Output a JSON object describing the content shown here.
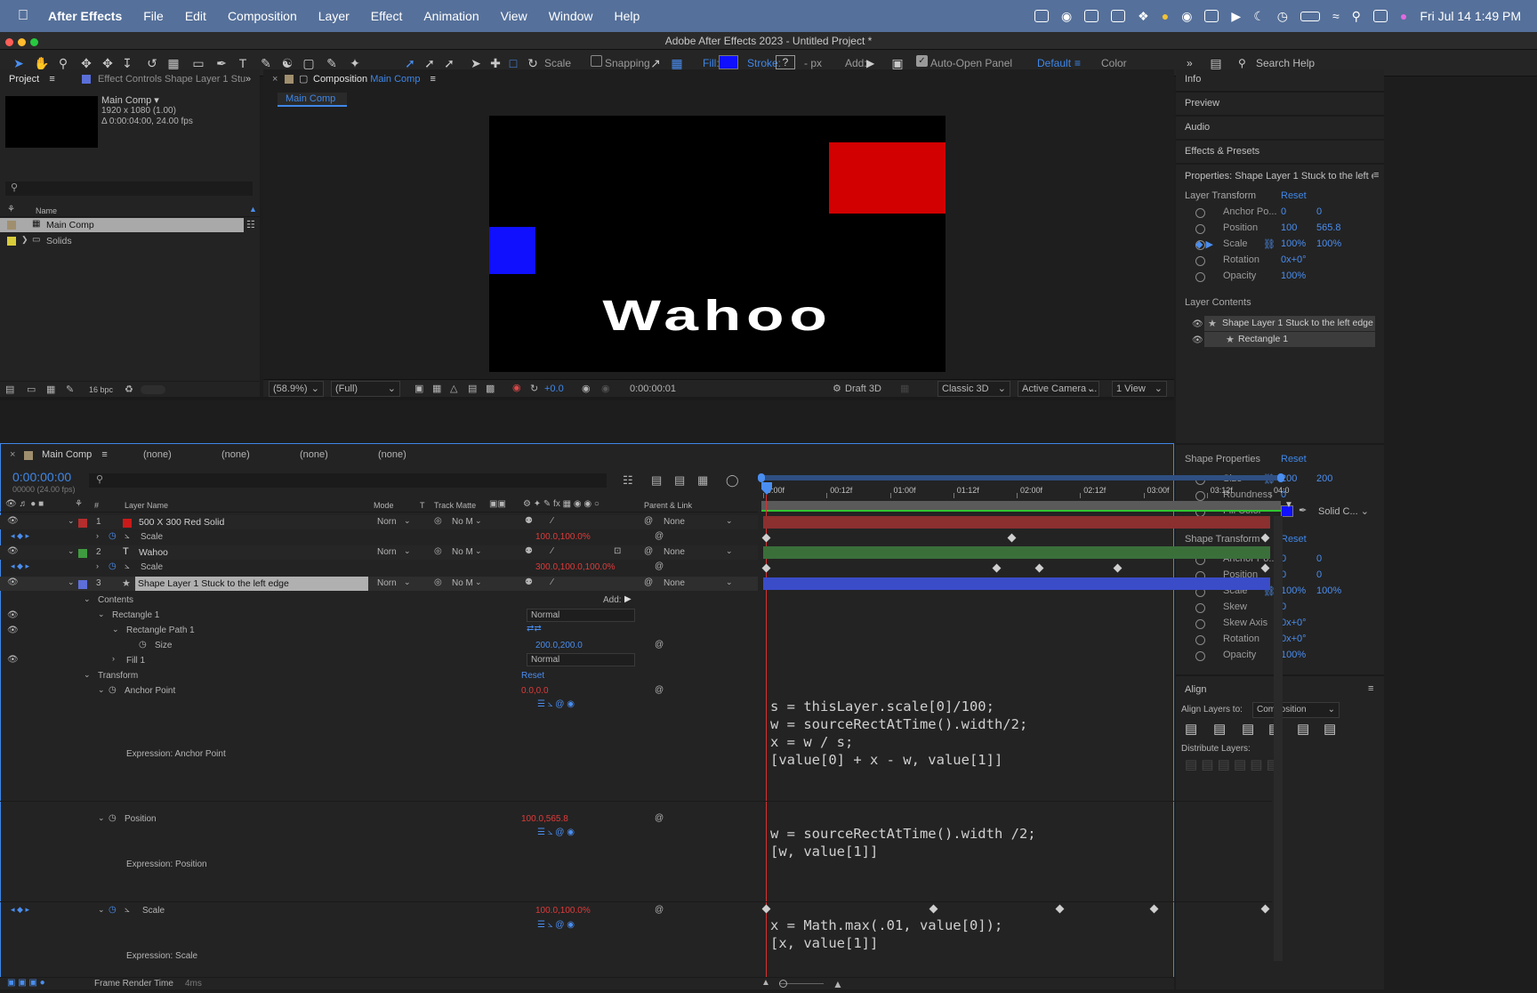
{
  "menubar": {
    "app": "After Effects",
    "items": [
      "File",
      "Edit",
      "Composition",
      "Layer",
      "Effect",
      "Animation",
      "View",
      "Window",
      "Help"
    ],
    "clock": "Fri Jul 14  1:49 PM"
  },
  "window": {
    "title": "Adobe After Effects 2023 - Untitled Project *"
  },
  "toolbar": {
    "scale_label": "Scale",
    "snapping": "Snapping",
    "fill": "Fill:",
    "stroke": "Stroke:",
    "stroke_val": "?",
    "px": "- px",
    "add": "Add:",
    "auto_open": "Auto-Open Panel",
    "workspace_default": "Default",
    "workspace_color": "Color",
    "search_help": "Search Help",
    "fill_color": "#1010ff"
  },
  "project": {
    "tab": "Project",
    "effect_tab": "Effect Controls Shape Layer 1 Stu",
    "comp_name": "Main Comp ▾",
    "comp_size": "1920 x 1080 (1.00)",
    "comp_dur": "Δ 0:00:04:00, 24.00 fps",
    "col_name": "Name",
    "items": [
      "Main Comp",
      "Solids"
    ],
    "bpc": "16 bpc"
  },
  "comp": {
    "tab_prefix": "Composition",
    "tab_name": "Main Comp",
    "subtab": "Main Comp",
    "text": "Wahoo",
    "zoom": "(58.9%)",
    "quality": "(Full)",
    "exposure": "+0.0",
    "time": "0:00:00:01",
    "draft": "Draft 3D",
    "renderer": "Classic 3D",
    "camera": "Active Camera ...",
    "view": "1 View",
    "red": "#d20000",
    "blue": "#1010ff"
  },
  "right_panels": {
    "info": "Info",
    "preview": "Preview",
    "audio": "Audio",
    "effects": "Effects & Presets"
  },
  "properties": {
    "title": "Properties: Shape Layer 1 Stuck to the left edg",
    "layer_transform": "Layer Transform",
    "reset": "Reset",
    "lt": [
      {
        "name": "Anchor Po...",
        "v1": "0",
        "v2": "0"
      },
      {
        "name": "Position",
        "v1": "100",
        "v2": "565.8"
      },
      {
        "name": "Scale",
        "v1": "100%",
        "v2": "100%"
      },
      {
        "name": "Rotation",
        "v1": "0x+0°",
        "v2": ""
      },
      {
        "name": "Opacity",
        "v1": "100%",
        "v2": ""
      }
    ],
    "layer_contents": "Layer Contents",
    "contents": [
      "Shape Layer 1 Stuck to the left edge",
      "Rectangle 1"
    ],
    "shape_properties": "Shape Properties",
    "sp": [
      {
        "name": "Size",
        "v1": "200",
        "v2": "200"
      },
      {
        "name": "Roundness",
        "v1": "0",
        "v2": ""
      },
      {
        "name": "Fill Color",
        "v1": "",
        "v2": ""
      }
    ],
    "fill_mode": "Solid C...",
    "shape_transform": "Shape Transform",
    "st": [
      {
        "name": "Anchor Po...",
        "v1": "0",
        "v2": "0"
      },
      {
        "name": "Position",
        "v1": "0",
        "v2": "0"
      },
      {
        "name": "Scale",
        "v1": "100%",
        "v2": "100%"
      },
      {
        "name": "Skew",
        "v1": "0",
        "v2": ""
      },
      {
        "name": "Skew Axis",
        "v1": "0x+0°",
        "v2": ""
      },
      {
        "name": "Rotation",
        "v1": "0x+0°",
        "v2": ""
      },
      {
        "name": "Opacity",
        "v1": "100%",
        "v2": ""
      }
    ]
  },
  "align": {
    "title": "Align",
    "align_to_label": "Align Layers to:",
    "align_to": "Composition",
    "distribute": "Distribute Layers:"
  },
  "viewer_tabs": [
    "(none)",
    "(none)",
    "(none)",
    "(none)"
  ],
  "timeline": {
    "tab": "Main Comp",
    "timecode": "0:00:00:00",
    "frames": "00000 (24.00 fps)",
    "cols": {
      "name": "Layer Name",
      "mode": "Mode",
      "t": "T",
      "matte": "Track Matte",
      "parent": "Parent & Link"
    },
    "ruler": [
      "0:00f",
      "00:12f",
      "01:00f",
      "01:12f",
      "02:00f",
      "02:12f",
      "03:00f",
      "03:12f",
      "04:0"
    ],
    "layers": [
      {
        "num": "1",
        "name": "500 X 300 Red Solid",
        "mode": "Norn",
        "matte": "No M",
        "parent": "None",
        "color": "#b52d2d",
        "sub": "Scale",
        "sub_val": "100.0,100.0%"
      },
      {
        "num": "2",
        "name": "Wahoo",
        "mode": "Norn",
        "matte": "No M",
        "parent": "None",
        "color": "#3f9b3f",
        "sub": "Scale",
        "sub_val": "300.0,100.0,100.0%"
      },
      {
        "num": "3",
        "name": "Shape Layer 1 Stuck to the left edge",
        "mode": "Norn",
        "matte": "No M",
        "parent": "None",
        "color": "#5d6fd8"
      }
    ],
    "contents": "Contents",
    "add": "Add:",
    "rect1": "Rectangle 1",
    "rect1_mode": "Normal",
    "rect_path": "Rectangle Path 1",
    "size": "Size",
    "size_val": "200.0,200.0",
    "fill1": "Fill 1",
    "fill_mode": "Normal",
    "transform": "Transform",
    "transform_reset": "Reset",
    "anchor": "Anchor Point",
    "anchor_val": "0.0,0.0",
    "expr_anchor": "Expression: Anchor Point",
    "position": "Position",
    "position_val": "100.0,565.8",
    "expr_position": "Expression: Position",
    "scale": "Scale",
    "scale_val": "100.0,100.0%",
    "expr_scale": "Expression: Scale",
    "code_anchor": [
      "s = thisLayer.scale[0]/100;",
      "w = sourceRectAtTime().width/2;",
      "x = w / s;",
      "[value[0] + x - w, value[1]]"
    ],
    "code_position": [
      "w = sourceRectAtTime().width /2;",
      "[w, value[1]]"
    ],
    "code_scale": [
      "x = Math.max(.01, value[0]);",
      "[x, value[1]]"
    ],
    "frame_render": "Frame Render Time",
    "frame_render_val": "4ms"
  }
}
